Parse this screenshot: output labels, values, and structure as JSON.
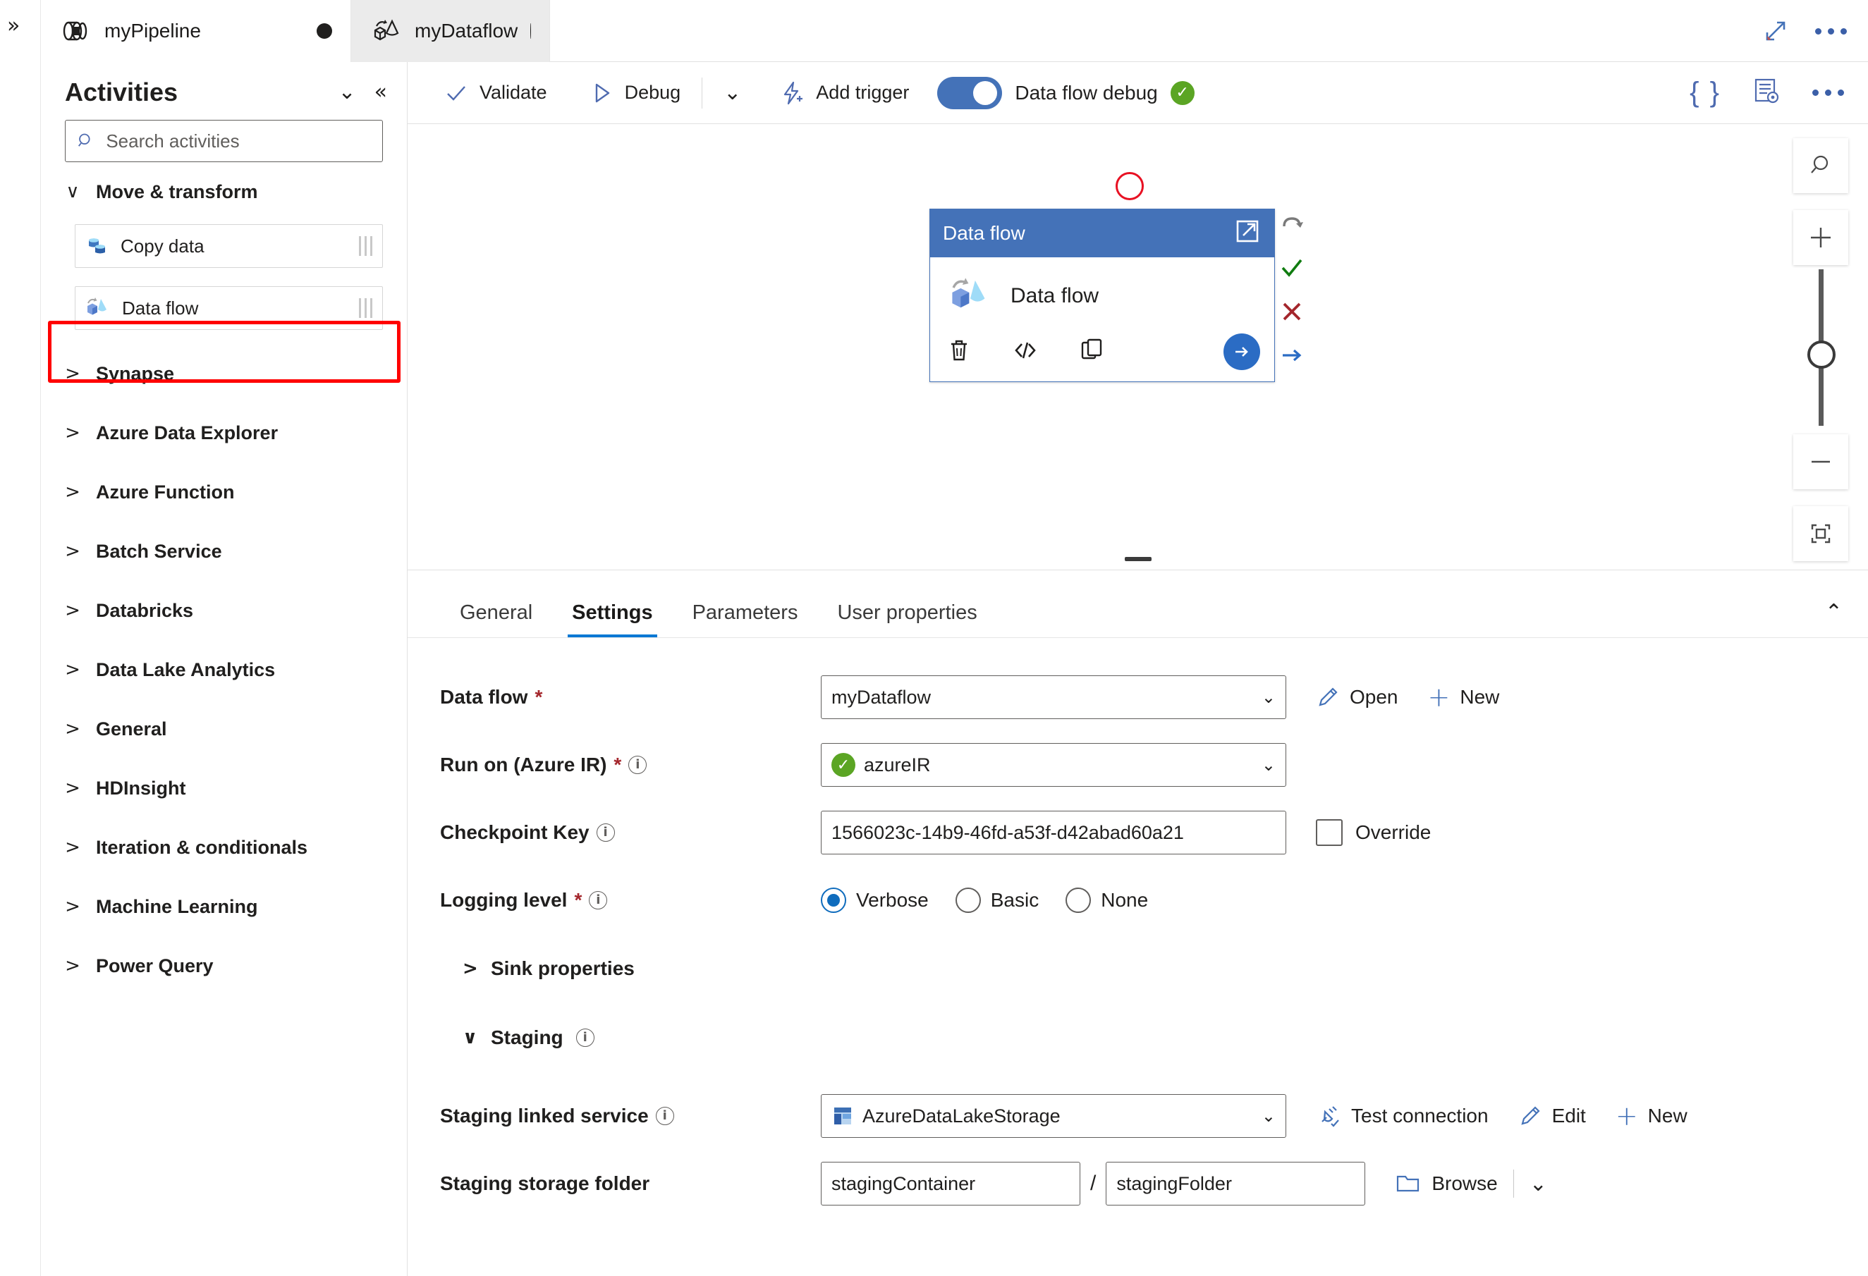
{
  "window": {
    "expand_icon": "expand-diagonal-icon",
    "overflow_icon": "more-options-icon",
    "rail_icon": "chevron-double-right-icon"
  },
  "tabs": [
    {
      "label": "myPipeline",
      "icon": "pipeline-icon",
      "dirty": true,
      "active": false
    },
    {
      "label": "myDataflow",
      "icon": "dataflow-icon",
      "dirty": true,
      "active": true
    }
  ],
  "sidebar": {
    "title": "Activities",
    "collapse_all_icon": "chevron-double-down-icon",
    "collapse_panel_icon": "chevron-double-left-icon",
    "search": {
      "placeholder": "Search activities",
      "value": "",
      "icon": "search-icon"
    },
    "groups": [
      {
        "label": "Move & transform",
        "expanded": true,
        "chevron": "∨",
        "items": [
          {
            "label": "Copy data",
            "icon": "copy-data-icon",
            "highlighted": false
          },
          {
            "label": "Data flow",
            "icon": "data-flow-icon",
            "highlighted": true
          }
        ]
      },
      {
        "label": "Synapse",
        "expanded": false,
        "chevron": ">",
        "items": []
      },
      {
        "label": "Azure Data Explorer",
        "expanded": false,
        "chevron": ">",
        "items": []
      },
      {
        "label": "Azure Function",
        "expanded": false,
        "chevron": ">",
        "items": []
      },
      {
        "label": "Batch Service",
        "expanded": false,
        "chevron": ">",
        "items": []
      },
      {
        "label": "Databricks",
        "expanded": false,
        "chevron": ">",
        "items": []
      },
      {
        "label": "Data Lake Analytics",
        "expanded": false,
        "chevron": ">",
        "items": []
      },
      {
        "label": "General",
        "expanded": false,
        "chevron": ">",
        "items": []
      },
      {
        "label": "HDInsight",
        "expanded": false,
        "chevron": ">",
        "items": []
      },
      {
        "label": "Iteration & conditionals",
        "expanded": false,
        "chevron": ">",
        "items": []
      },
      {
        "label": "Machine Learning",
        "expanded": false,
        "chevron": ">",
        "items": []
      },
      {
        "label": "Power Query",
        "expanded": false,
        "chevron": ">",
        "items": []
      }
    ]
  },
  "commandbar": {
    "validate": "Validate",
    "debug": "Debug",
    "debug_dropdown_icon": "chevron-down-icon",
    "add_trigger": "Add trigger",
    "data_flow_debug": "Data flow debug",
    "data_flow_debug_on": true,
    "data_flow_debug_status": "ready",
    "code_icon": "{ }",
    "properties_icon": "pipeline-properties-icon",
    "more_icon": "more-options-icon"
  },
  "canvas": {
    "node": {
      "header_title": "Data flow",
      "open_icon": "open-new-window-icon",
      "body_label": "Data flow",
      "body_icon": "data-flow-icon",
      "actions": [
        "delete-icon",
        "code-icon",
        "clone-icon",
        "run-arrow-icon"
      ],
      "status_marker": "red-circle-incomplete",
      "ports": [
        "retry-port",
        "success-port",
        "failure-port",
        "completion-port"
      ]
    },
    "zoom_controls": [
      "search-icon",
      "zoom-in-icon",
      "zoom-slider",
      "zoom-out-icon",
      "fit-to-screen-icon"
    ]
  },
  "properties": {
    "tabs": [
      {
        "label": "General",
        "active": false
      },
      {
        "label": "Settings",
        "active": true
      },
      {
        "label": "Parameters",
        "active": false
      },
      {
        "label": "User properties",
        "active": false
      }
    ],
    "collapse_icon": "chevron-up-icon",
    "fields": {
      "data_flow": {
        "label": "Data flow",
        "required": true,
        "value": "myDataflow",
        "open_label": "Open",
        "open_icon": "pencil-icon",
        "new_label": "New",
        "new_icon": "plus-icon"
      },
      "run_on": {
        "label": "Run on (Azure IR)",
        "required": true,
        "has_info": true,
        "value": "azureIR",
        "status_icon": "green-check-icon"
      },
      "checkpoint_key": {
        "label": "Checkpoint Key",
        "has_info": true,
        "value": "1566023c-14b9-46fd-a53f-d42abad60a21",
        "override_label": "Override",
        "override_checked": false
      },
      "logging_level": {
        "label": "Logging level",
        "required": true,
        "has_info": true,
        "selected": "Verbose",
        "options": [
          "Verbose",
          "Basic",
          "None"
        ]
      },
      "sink_properties": {
        "label": "Sink properties",
        "expanded": false,
        "chevron": ">"
      },
      "staging": {
        "label": "Staging",
        "expanded": true,
        "chevron": "∨",
        "has_info": true
      },
      "staging_linked_service": {
        "label": "Staging linked service",
        "has_info": true,
        "value": "AzureDataLakeStorage",
        "icon": "azure-storage-icon",
        "test_connection_label": "Test connection",
        "test_connection_icon": "plug-check-icon",
        "edit_label": "Edit",
        "edit_icon": "pencil-icon",
        "new_label": "New",
        "new_icon": "plus-icon"
      },
      "staging_storage_folder": {
        "label": "Staging storage folder",
        "container": "stagingContainer",
        "separator": "/",
        "folder": "stagingFolder",
        "browse_label": "Browse",
        "browse_icon": "folder-icon",
        "browse_dropdown_icon": "chevron-down-icon"
      }
    }
  },
  "colors": {
    "accent": "#0078d4",
    "node_header": "#4472b8",
    "highlight": "#ff0000",
    "success": "#5ba524",
    "error": "#a4262c",
    "link": "#4472b8"
  }
}
